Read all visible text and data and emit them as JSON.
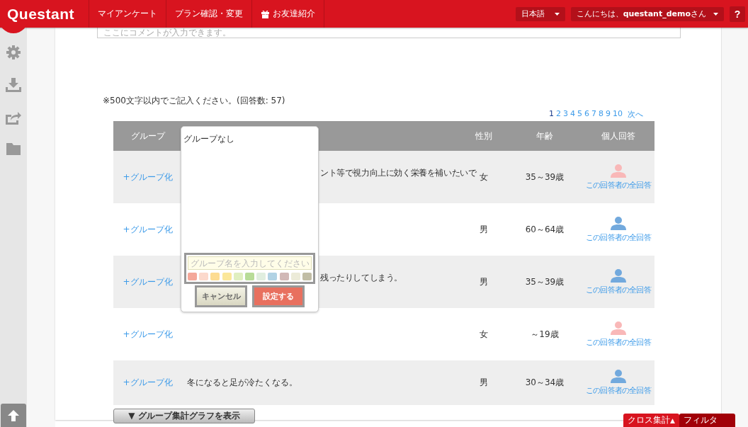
{
  "header": {
    "logo": "Questant",
    "nav": [
      {
        "label": "マイアンケート",
        "kind": "link"
      },
      {
        "label": "プラン確認・変更",
        "kind": "link"
      },
      {
        "label": "お友達紹介",
        "kind": "gift"
      }
    ],
    "language": "日本語",
    "greeting": "こんにちは、**questant_demo**さん",
    "help": "?"
  },
  "comment_field": {
    "placeholder": "ここにコメントが入力できます。"
  },
  "note": "※500文字以内でご記入ください。(回答数: 57)",
  "pagination": {
    "pages": [
      {
        "label": "1",
        "selected": true
      },
      {
        "label": "2",
        "selected": false
      },
      {
        "label": "3",
        "selected": false
      },
      {
        "label": "4",
        "selected": false
      },
      {
        "label": "5",
        "selected": false
      },
      {
        "label": "6",
        "selected": false
      },
      {
        "label": "7",
        "selected": false
      },
      {
        "label": "8",
        "selected": false
      },
      {
        "label": "9",
        "selected": false
      },
      {
        "label": "10",
        "selected": false
      }
    ],
    "next": "次へ"
  },
  "table": {
    "columns": [
      "グループ",
      "性別",
      "年齢",
      "個人回答"
    ],
    "rows": [
      {
        "group": "+グループ化",
        "answer": "ント等で視力向上に効く栄養を補いたいで",
        "gender": "女",
        "age": "35～39歳",
        "color": "#f9b8b8",
        "link": "この回答者の全回答"
      },
      {
        "group": "+グループ化",
        "gender": "男",
        "age": "60～64歳",
        "color": "#72a9dd",
        "link": "この回答者の全回答"
      },
      {
        "group": "+グループ化",
        "answer": "残ったりしてしまう。",
        "gender": "男",
        "age": "35～39歳",
        "color": "#72a9dd",
        "link": "この回答者の全回答"
      },
      {
        "group": "+グループ化",
        "gender": "女",
        "age": "～19歳",
        "color": "#f9b8b8",
        "link": "この回答者の全回答"
      },
      {
        "group": "+グループ化",
        "answer": "冬になると足が冷たくなる。",
        "gender": "男",
        "age": "30～34歳",
        "color": "#72a9dd",
        "link": "この回答者の全回答"
      }
    ]
  },
  "group_popup": {
    "title": "グループなし",
    "placeholder": "グループ名を入力してください",
    "swatches": [
      {
        "color": "#f4a89a"
      },
      {
        "color": "#fcd9cc"
      },
      {
        "color": "#fddc92"
      },
      {
        "color": "#fbe79a"
      },
      {
        "color": "#e0efc0"
      },
      {
        "color": "#b8dc98"
      },
      {
        "color": "#e0eedf"
      },
      {
        "color": "#b1d2e4"
      },
      {
        "color": "#d1b8b6"
      },
      {
        "color": "#ecebd8"
      },
      {
        "color": "#c1bda5"
      }
    ],
    "cancel": "キャンセル",
    "confirm": "設定する"
  },
  "graph_button": "▼ グループ集計グラフを表示",
  "bottom_tabs": [
    {
      "label": "クロス集計",
      "arrow": "▲",
      "selected": true
    },
    {
      "label": "フィルタ",
      "selected": false
    }
  ]
}
